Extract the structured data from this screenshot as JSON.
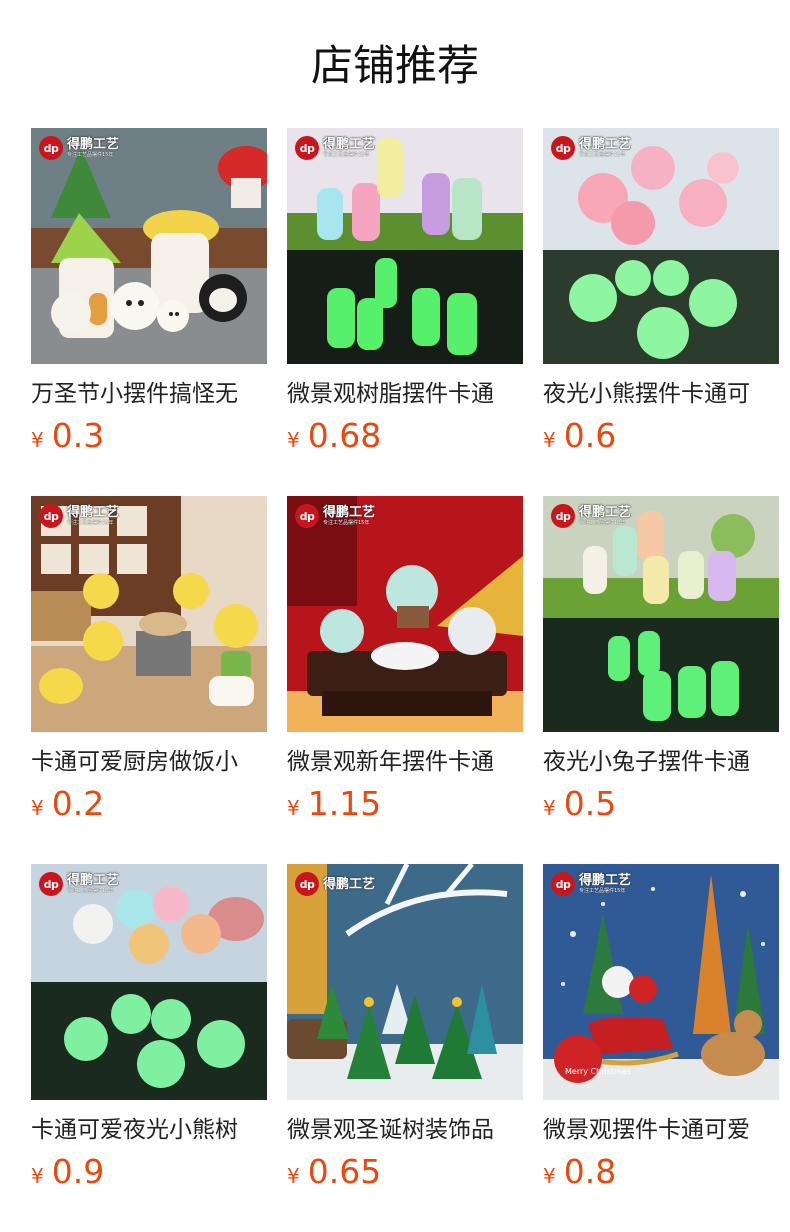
{
  "page": {
    "title": "店铺推荐"
  },
  "brand": {
    "logo": "dp",
    "name": "得鹏工艺",
    "slogan": "专注工艺品摆件15年"
  },
  "products": [
    {
      "title": "万圣节小摆件搞怪无",
      "currency": "¥",
      "price": "0.3",
      "image": "halloween-mushroom-houses"
    },
    {
      "title": "微景观树脂摆件卡通",
      "currency": "¥",
      "price": "0.68",
      "image": "glow-alpacas"
    },
    {
      "title": "夜光小熊摆件卡通可",
      "currency": "¥",
      "price": "0.6",
      "image": "glow-bears-pink"
    },
    {
      "title": "卡通可爱厨房做饭小",
      "currency": "¥",
      "price": "0.2",
      "image": "kitchen-ducks"
    },
    {
      "title": "微景观新年摆件卡通",
      "currency": "¥",
      "price": "1.15",
      "image": "new-year-dragons"
    },
    {
      "title": "夜光小兔子摆件卡通",
      "currency": "¥",
      "price": "0.5",
      "image": "glow-rabbits"
    },
    {
      "title": "卡通可爱夜光小熊树",
      "currency": "¥",
      "price": "0.9",
      "image": "glow-bears-tree"
    },
    {
      "title": "微景观圣诞树装饰品",
      "currency": "¥",
      "price": "0.65",
      "image": "christmas-trees"
    },
    {
      "title": "微景观摆件卡通可爱",
      "currency": "¥",
      "price": "0.8",
      "image": "santa-sleigh"
    }
  ],
  "image_texts": {
    "merry_christmas": "Merry Christmas"
  }
}
